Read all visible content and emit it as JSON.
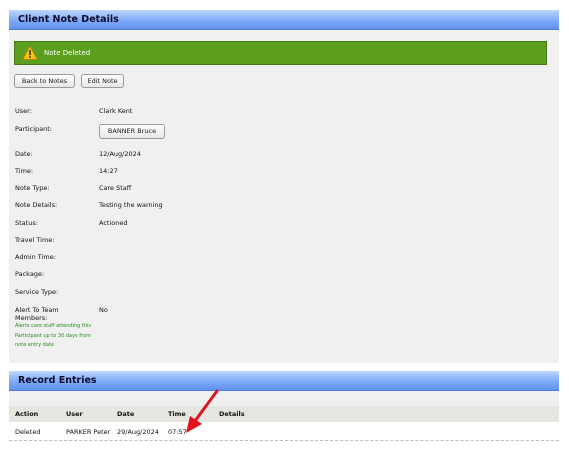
{
  "header": {
    "title": "Client Note Details"
  },
  "alert": {
    "message": "Note Deleted",
    "color": "#5c9e1d"
  },
  "buttons": {
    "back": "Back to Notes",
    "edit": "Edit Note",
    "participant": "BANNER Bruce"
  },
  "fields": {
    "user": {
      "label": "User:",
      "value": "Clark Kent"
    },
    "participant": {
      "label": "Participant:"
    },
    "date": {
      "label": "Date:",
      "value": "12/Aug/2024"
    },
    "time": {
      "label": "Time:",
      "value": "14:27"
    },
    "note_type": {
      "label": "Note Type:",
      "value": "Care Staff"
    },
    "note_details": {
      "label": "Note Details:",
      "value": "Testing the warning"
    },
    "status": {
      "label": "Status:",
      "value": "Actioned"
    },
    "travel_time": {
      "label": "Travel Time:"
    },
    "admin_time": {
      "label": "Admin Time:"
    },
    "package": {
      "label": "Package:"
    },
    "service_type": {
      "label": "Service Type:"
    },
    "alert_team": {
      "label_line1": "Alert To Team",
      "label_line2": "Members:",
      "value": "No",
      "hint": "Alerts care staff attending this Participant up to 30 days from note entry date"
    }
  },
  "record_entries": {
    "title": "Record Entries",
    "columns": [
      "Action",
      "User",
      "Date",
      "Time",
      "Details"
    ],
    "rows": [
      {
        "action": "Deleted",
        "user": "PARKER Peter",
        "date": "29/Aug/2024",
        "time": "07:57",
        "details": ""
      }
    ]
  },
  "colors": {
    "header_blue": "#7faaf7",
    "alert_green": "#5c9e1d",
    "annotation_arrow": "#e0141e"
  },
  "icons": {
    "alert_icon": "warning-triangle-icon",
    "annotation": "red-arrow-icon"
  }
}
